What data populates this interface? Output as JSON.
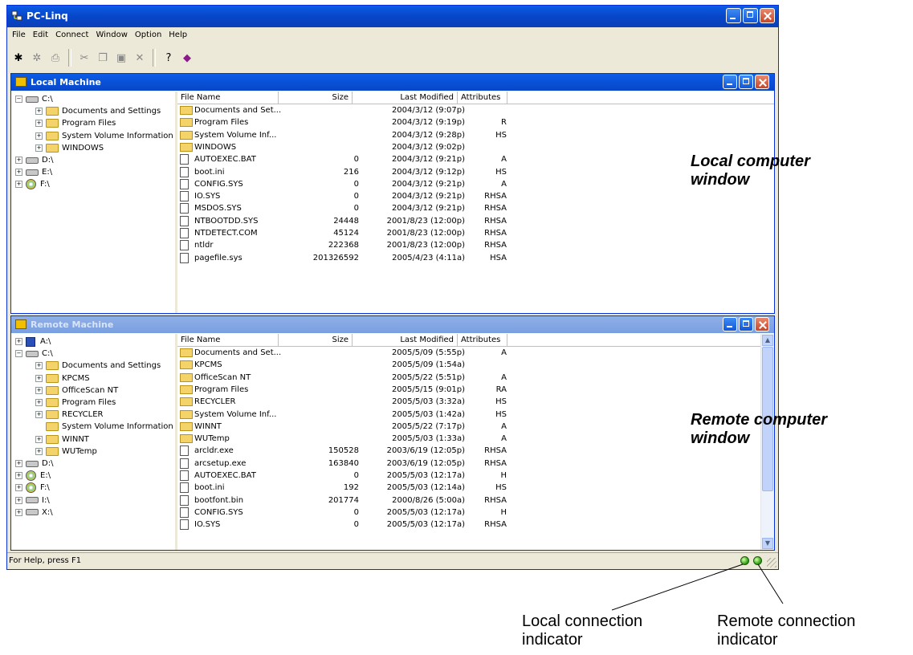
{
  "app": {
    "title": "PC-Linq"
  },
  "menu": [
    "File",
    "Edit",
    "Connect",
    "Window",
    "Option",
    "Help"
  ],
  "toolbar": [
    "connect-icon",
    "disconnect-icon",
    "print-icon",
    "cut-icon",
    "copy-icon",
    "paste-icon",
    "delete-icon",
    "help-icon",
    "book-icon"
  ],
  "columns": {
    "name": "File Name",
    "size": "Size",
    "modified": "Last Modified",
    "attributes": "Attributes"
  },
  "local": {
    "title": "Local Machine",
    "tree": [
      {
        "label": "C:\\",
        "indent": 0,
        "kind": "drive",
        "exp": "−"
      },
      {
        "label": "Documents and Settings",
        "indent": 1,
        "kind": "folder",
        "exp": "+"
      },
      {
        "label": "Program Files",
        "indent": 1,
        "kind": "folder",
        "exp": "+"
      },
      {
        "label": "System Volume Information",
        "indent": 1,
        "kind": "folder",
        "exp": "+"
      },
      {
        "label": "WINDOWS",
        "indent": 1,
        "kind": "folder",
        "exp": "+"
      },
      {
        "label": "D:\\",
        "indent": 0,
        "kind": "drive",
        "exp": "+"
      },
      {
        "label": "E:\\",
        "indent": 0,
        "kind": "drive",
        "exp": "+"
      },
      {
        "label": "F:\\",
        "indent": 0,
        "kind": "cd",
        "exp": "+"
      }
    ],
    "files": [
      {
        "name": "Documents and Set...",
        "size": "",
        "modified": "2004/3/12 (9:07p)",
        "attr": "",
        "type": "folder"
      },
      {
        "name": "Program Files",
        "size": "",
        "modified": "2004/3/12 (9:19p)",
        "attr": "R",
        "type": "folder"
      },
      {
        "name": "System Volume Inf...",
        "size": "",
        "modified": "2004/3/12 (9:28p)",
        "attr": "HS",
        "type": "folder"
      },
      {
        "name": "WINDOWS",
        "size": "",
        "modified": "2004/3/12 (9:02p)",
        "attr": "",
        "type": "folder"
      },
      {
        "name": "AUTOEXEC.BAT",
        "size": "0",
        "modified": "2004/3/12 (9:21p)",
        "attr": "A",
        "type": "file"
      },
      {
        "name": "boot.ini",
        "size": "216",
        "modified": "2004/3/12 (9:12p)",
        "attr": "HS",
        "type": "file"
      },
      {
        "name": "CONFIG.SYS",
        "size": "0",
        "modified": "2004/3/12 (9:21p)",
        "attr": "A",
        "type": "file"
      },
      {
        "name": "IO.SYS",
        "size": "0",
        "modified": "2004/3/12 (9:21p)",
        "attr": "RHSA",
        "type": "file"
      },
      {
        "name": "MSDOS.SYS",
        "size": "0",
        "modified": "2004/3/12 (9:21p)",
        "attr": "RHSA",
        "type": "file"
      },
      {
        "name": "NTBOOTDD.SYS",
        "size": "24448",
        "modified": "2001/8/23 (12:00p)",
        "attr": "RHSA",
        "type": "file"
      },
      {
        "name": "NTDETECT.COM",
        "size": "45124",
        "modified": "2001/8/23 (12:00p)",
        "attr": "RHSA",
        "type": "file"
      },
      {
        "name": "ntldr",
        "size": "222368",
        "modified": "2001/8/23 (12:00p)",
        "attr": "RHSA",
        "type": "file"
      },
      {
        "name": "pagefile.sys",
        "size": "201326592",
        "modified": "2005/4/23 (4:11a)",
        "attr": "HSA",
        "type": "file"
      }
    ]
  },
  "remote": {
    "title": "Remote Machine",
    "tree": [
      {
        "label": "A:\\",
        "indent": 0,
        "kind": "floppy",
        "exp": "+"
      },
      {
        "label": "C:\\",
        "indent": 0,
        "kind": "drive",
        "exp": "−"
      },
      {
        "label": "Documents and Settings",
        "indent": 1,
        "kind": "folder",
        "exp": "+"
      },
      {
        "label": "KPCMS",
        "indent": 1,
        "kind": "folder",
        "exp": "+"
      },
      {
        "label": "OfficeScan NT",
        "indent": 1,
        "kind": "folder",
        "exp": "+"
      },
      {
        "label": "Program Files",
        "indent": 1,
        "kind": "folder",
        "exp": "+"
      },
      {
        "label": "RECYCLER",
        "indent": 1,
        "kind": "folder",
        "exp": "+"
      },
      {
        "label": "System Volume Information",
        "indent": 1,
        "kind": "folder",
        "exp": ""
      },
      {
        "label": "WINNT",
        "indent": 1,
        "kind": "folder",
        "exp": "+"
      },
      {
        "label": "WUTemp",
        "indent": 1,
        "kind": "folder",
        "exp": "+"
      },
      {
        "label": "D:\\",
        "indent": 0,
        "kind": "drive",
        "exp": "+"
      },
      {
        "label": "E:\\",
        "indent": 0,
        "kind": "cd",
        "exp": "+"
      },
      {
        "label": "F:\\",
        "indent": 0,
        "kind": "cd",
        "exp": "+"
      },
      {
        "label": "I:\\",
        "indent": 0,
        "kind": "drive",
        "exp": "+"
      },
      {
        "label": "X:\\",
        "indent": 0,
        "kind": "drive",
        "exp": "+"
      }
    ],
    "files": [
      {
        "name": "Documents and Set...",
        "size": "",
        "modified": "2005/5/09 (5:55p)",
        "attr": "A",
        "type": "folder"
      },
      {
        "name": "KPCMS",
        "size": "",
        "modified": "2005/5/09 (1:54a)",
        "attr": "",
        "type": "folder"
      },
      {
        "name": "OfficeScan NT",
        "size": "",
        "modified": "2005/5/22 (5:51p)",
        "attr": "A",
        "type": "folder"
      },
      {
        "name": "Program Files",
        "size": "",
        "modified": "2005/5/15 (9:01p)",
        "attr": "RA",
        "type": "folder"
      },
      {
        "name": "RECYCLER",
        "size": "",
        "modified": "2005/5/03 (3:32a)",
        "attr": "HS",
        "type": "folder"
      },
      {
        "name": "System Volume Inf...",
        "size": "",
        "modified": "2005/5/03 (1:42a)",
        "attr": "HS",
        "type": "folder"
      },
      {
        "name": "WINNT",
        "size": "",
        "modified": "2005/5/22 (7:17p)",
        "attr": "A",
        "type": "folder"
      },
      {
        "name": "WUTemp",
        "size": "",
        "modified": "2005/5/03 (1:33a)",
        "attr": "A",
        "type": "folder"
      },
      {
        "name": "arcldr.exe",
        "size": "150528",
        "modified": "2003/6/19 (12:05p)",
        "attr": "RHSA",
        "type": "file"
      },
      {
        "name": "arcsetup.exe",
        "size": "163840",
        "modified": "2003/6/19 (12:05p)",
        "attr": "RHSA",
        "type": "file"
      },
      {
        "name": "AUTOEXEC.BAT",
        "size": "0",
        "modified": "2005/5/03 (12:17a)",
        "attr": "H",
        "type": "file"
      },
      {
        "name": "boot.ini",
        "size": "192",
        "modified": "2005/5/03 (12:14a)",
        "attr": "HS",
        "type": "file"
      },
      {
        "name": "bootfont.bin",
        "size": "201774",
        "modified": "2000/8/26 (5:00a)",
        "attr": "RHSA",
        "type": "file"
      },
      {
        "name": "CONFIG.SYS",
        "size": "0",
        "modified": "2005/5/03 (12:17a)",
        "attr": "H",
        "type": "file"
      },
      {
        "name": "IO.SYS",
        "size": "0",
        "modified": "2005/5/03 (12:17a)",
        "attr": "RHSA",
        "type": "file"
      }
    ]
  },
  "status": {
    "text": "For Help, press F1"
  },
  "annotations": {
    "local_window": [
      "Local computer",
      "window"
    ],
    "remote_window": [
      "Remote computer",
      "window"
    ],
    "local_indicator": [
      "Local connection",
      "indicator"
    ],
    "remote_indicator": [
      "Remote connection",
      "indicator"
    ]
  }
}
